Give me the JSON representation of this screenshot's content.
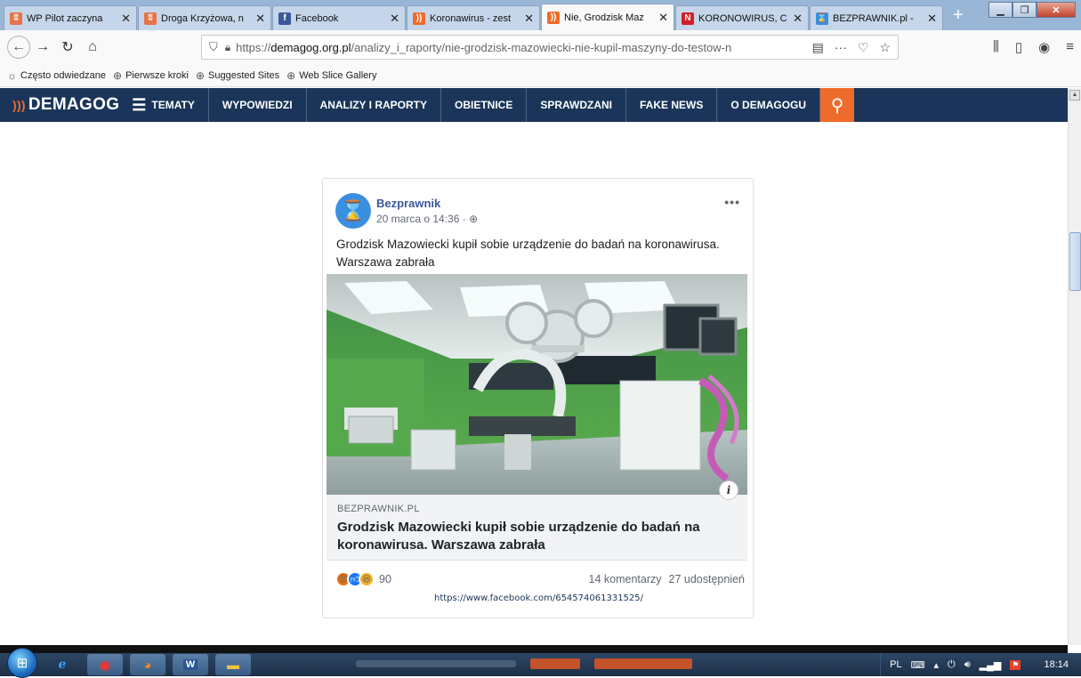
{
  "browser": {
    "tabs": [
      {
        "title": "WP Pilot zaczyna",
        "icon_color": "#e8734a",
        "icon": "wp-icon",
        "glyph": "ʬ"
      },
      {
        "title": "Droga Krzyżowa, n",
        "icon_color": "#e8734a",
        "icon": "wp-icon",
        "glyph": "ʬ"
      },
      {
        "title": "Facebook",
        "icon_color": "#3b5998",
        "icon": "facebook-icon",
        "glyph": "f"
      },
      {
        "title": "Koronawirus - zest",
        "icon_color": "#ef6b2b",
        "icon": "demagog-icon",
        "glyph": "))"
      },
      {
        "title": "Nie, Grodzisk Maz",
        "icon_color": "#ef6b2b",
        "icon": "demagog-icon",
        "glyph": "))"
      },
      {
        "title": "KORONOWIRUS, C",
        "icon_color": "#d11f25",
        "icon": "news-icon",
        "glyph": "N"
      },
      {
        "title": "BEZPRAWNIK.pl -",
        "icon_color": "#3b8fe0",
        "icon": "hourglass-icon",
        "glyph": "⌛"
      }
    ],
    "active_tab": 4,
    "new_tab": "+",
    "url_prefix": "https://",
    "url_domain": "demagog.org.pl",
    "url_path": "/analizy_i_raporty/nie-grodzisk-mazowiecki-nie-kupil-maszyny-do-testow-n",
    "bookmarks": [
      {
        "label": "Często odwiedzane",
        "icon": "gear-icon",
        "glyph": "☼"
      },
      {
        "label": "Pierwsze kroki",
        "icon": "globe-icon",
        "glyph": "⊕"
      },
      {
        "label": "Suggested Sites",
        "icon": "globe-icon",
        "glyph": "⊕"
      },
      {
        "label": "Web Slice Gallery",
        "icon": "globe-icon",
        "glyph": "⊕"
      }
    ]
  },
  "site": {
    "logo": "DEMAGOG",
    "nav": [
      "TEMATY",
      "WYPOWIEDZI",
      "ANALIZY I RAPORTY",
      "OBIETNICE",
      "SPRAWDZANI",
      "FAKE NEWS",
      "O DEMAGOGU"
    ],
    "accent": "#ef6b2b",
    "nav_bg": "#1a3559"
  },
  "post": {
    "author": "Bezprawnik",
    "date": "20 marca o 14:36 ·",
    "text": "Grodzisk Mazowiecki kupił sobie urządzenie do badań na koronawirusa. Warszawa zabrała",
    "link_domain": "BEZPRAWNIK.PL",
    "link_title": "Grodzisk Mazowiecki kupił sobie urządzenie do badań na koronawirusa. Warszawa zabrała",
    "reaction_count": "90",
    "comments": "14 komentarzy",
    "shares": "27 udostępnień",
    "source_url": "https://www.facebook.com/654574061331525/"
  },
  "taskbar": {
    "lang": "PL",
    "time": "18:14"
  }
}
